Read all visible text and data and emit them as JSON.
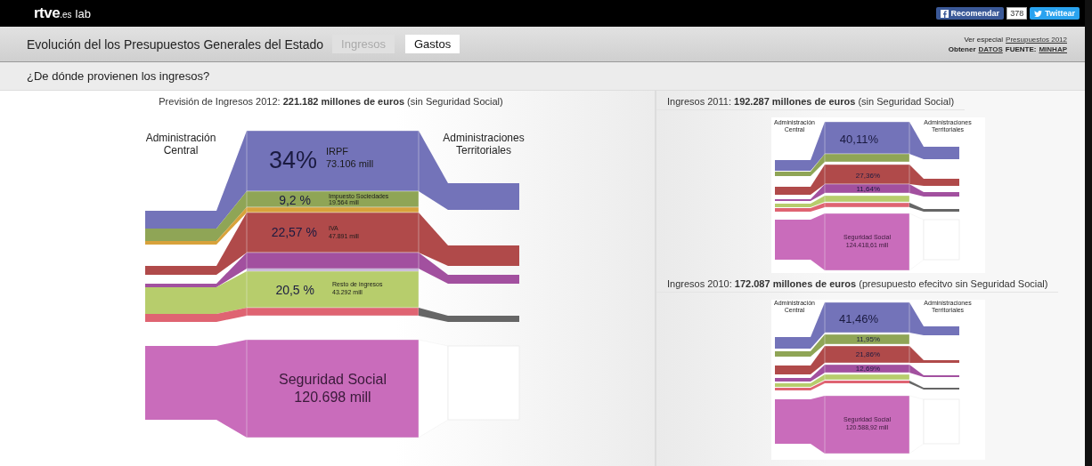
{
  "topbar": {
    "brand": "rtve",
    "suffix": ".es",
    "lab": "lab",
    "like": "Recomendar",
    "count": "378",
    "tweet": "Twittear"
  },
  "header": {
    "title": "Evolución del los Presupuestos Generales del Estado",
    "tabs": [
      {
        "label": "Ingresos",
        "selected": true
      },
      {
        "label": "Gastos",
        "selected": false
      }
    ],
    "special_label": "Ver especial",
    "special_link": "Presupuestos 2012",
    "data_label": "Obtener",
    "data_link": "DATOS",
    "source_label": "FUENTE:",
    "source_link": "MINHAP"
  },
  "question": "¿De dónde provienen los ingresos?",
  "charts": [
    {
      "kind": "large",
      "title": "Previsión de Ingresos 2012: **221.182 millones de euros** (sin Seguridad Social)",
      "left_label": "Administración Central",
      "right_label": "Administraciones Territoriales",
      "segments": [
        {
          "color": "#7373b9",
          "percent": "34%",
          "name": "IRPF",
          "amount": "73.106 mill"
        },
        {
          "color": "#8fa556",
          "percent": "9,2 %",
          "name": "Impuesto Sociedades",
          "amount": "19.564 mill"
        },
        {
          "color": "#d8a23b"
        },
        {
          "color": "#b04a4a",
          "percent": "22,57 %",
          "name": "IVA",
          "amount": "47.891 mill"
        },
        {
          "color": "#a2509f"
        },
        {
          "color": "#c8b8d8"
        },
        {
          "color": "#b7cd6c",
          "percent": "20,5 %",
          "name": "Resto de ingresos",
          "amount": "43.292 mill"
        },
        {
          "color": "#df6472"
        },
        {
          "color": "#666666"
        },
        {
          "color": "#c96cbb",
          "name": "Seguridad Social",
          "amount": "120.698 mill"
        }
      ]
    },
    {
      "kind": "small",
      "title": "Ingresos 2011: **192.287 millones de euros** (sin Seguridad Social)",
      "left_label": "Administración Central",
      "right_label": "Administraciones Territoriales",
      "segments": [
        {
          "color": "#7373b9",
          "percent": "40,11%"
        },
        {
          "color": "#8fa556"
        },
        {
          "color": "#b04a4a",
          "percent": "27,36%"
        },
        {
          "color": "#a2509f",
          "percent": "11,64%"
        },
        {
          "color": "#b7cd6c"
        },
        {
          "color": "#df6472"
        },
        {
          "color": "#666666"
        },
        {
          "color": "#c96cbb",
          "name": "Seguridad Social",
          "amount": "124.418,61 mill"
        }
      ]
    },
    {
      "kind": "small",
      "title": "Ingresos 2010: **172.087 millones de euros** (presupuesto efecitvo sin Seguridad Social)",
      "left_label": "Administración Central",
      "right_label": "Administraciones Territoriales",
      "segments": [
        {
          "color": "#7373b9",
          "percent": "41,46%"
        },
        {
          "color": "#8fa556",
          "percent": "11,95%"
        },
        {
          "color": "#b04a4a",
          "percent": "21,86%"
        },
        {
          "color": "#a2509f",
          "percent": "12,69%"
        },
        {
          "color": "#b7cd6c"
        },
        {
          "color": "#df6472"
        },
        {
          "color": "#666666"
        },
        {
          "color": "#c96cbb",
          "name": "Seguridad Social",
          "amount": "120.588,92 mill"
        }
      ]
    }
  ]
}
